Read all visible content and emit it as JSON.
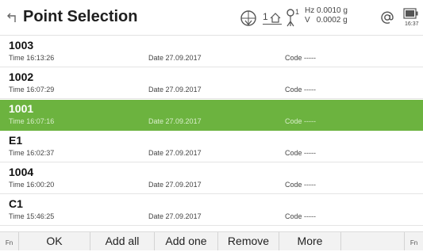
{
  "header": {
    "title": "Point Selection",
    "face_indicator": "1",
    "prism_indicator": "1",
    "hz_label": "Hz",
    "hz_value": "0.0010 g",
    "v_label": "V",
    "v_value": "0.0002 g",
    "time": "16:37",
    "icons": [
      "back-icon",
      "crosshair-icon",
      "face-indicator-icon",
      "prism-icon",
      "at-icon",
      "battery-icon"
    ]
  },
  "labels": {
    "time": "Time",
    "date": "Date",
    "code": "Code"
  },
  "points": [
    {
      "name": "1003",
      "time": "16:13:26",
      "date": "27.09.2017",
      "code": "-----",
      "selected": false
    },
    {
      "name": "1002",
      "time": "16:07:29",
      "date": "27.09.2017",
      "code": "-----",
      "selected": false
    },
    {
      "name": "1001",
      "time": "16:07:16",
      "date": "27.09.2017",
      "code": "-----",
      "selected": true
    },
    {
      "name": "E1",
      "time": "16:02:37",
      "date": "27.09.2017",
      "code": "-----",
      "selected": false
    },
    {
      "name": "1004",
      "time": "16:00:20",
      "date": "27.09.2017",
      "code": "-----",
      "selected": false
    },
    {
      "name": "C1",
      "time": "15:46:25",
      "date": "27.09.2017",
      "code": "-----",
      "selected": false
    }
  ],
  "footer": {
    "fn_left": "Fn",
    "ok": "OK",
    "add_all": "Add all",
    "add_one": "Add one",
    "remove": "Remove",
    "more": "More",
    "fn_right": "Fn"
  },
  "colors": {
    "selected_row": "#6cb33f"
  }
}
